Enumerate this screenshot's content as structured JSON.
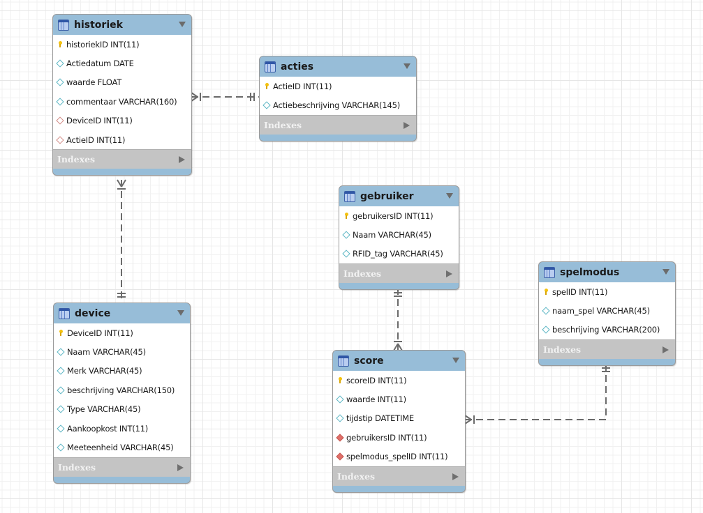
{
  "diagram": {
    "type": "EER diagram",
    "indexes_label": "Indexes",
    "tables": [
      {
        "id": "historiek",
        "name": "historiek",
        "columns": [
          {
            "label": "historiekID INT(11)",
            "kind": "primary-key"
          },
          {
            "label": "Actiedatum DATE",
            "kind": "column"
          },
          {
            "label": "waarde FLOAT",
            "kind": "column"
          },
          {
            "label": "commentaar VARCHAR(160)",
            "kind": "column"
          },
          {
            "label": "DeviceID INT(11)",
            "kind": "foreign-key"
          },
          {
            "label": "ActieID INT(11)",
            "kind": "foreign-key"
          }
        ]
      },
      {
        "id": "acties",
        "name": "acties",
        "columns": [
          {
            "label": "ActieID INT(11)",
            "kind": "primary-key"
          },
          {
            "label": "Actiebeschrijving VARCHAR(145)",
            "kind": "column"
          }
        ]
      },
      {
        "id": "device",
        "name": "device",
        "columns": [
          {
            "label": "DeviceID INT(11)",
            "kind": "primary-key"
          },
          {
            "label": "Naam VARCHAR(45)",
            "kind": "column"
          },
          {
            "label": "Merk VARCHAR(45)",
            "kind": "column"
          },
          {
            "label": "beschrijving VARCHAR(150)",
            "kind": "column"
          },
          {
            "label": "Type VARCHAR(45)",
            "kind": "column"
          },
          {
            "label": "Aankoopkost INT(11)",
            "kind": "column"
          },
          {
            "label": "Meeteenheid VARCHAR(45)",
            "kind": "column"
          }
        ]
      },
      {
        "id": "gebruiker",
        "name": "gebruiker",
        "columns": [
          {
            "label": "gebruikersID INT(11)",
            "kind": "primary-key"
          },
          {
            "label": "Naam VARCHAR(45)",
            "kind": "column"
          },
          {
            "label": "RFID_tag VARCHAR(45)",
            "kind": "column"
          }
        ]
      },
      {
        "id": "score",
        "name": "score",
        "columns": [
          {
            "label": "scoreID INT(11)",
            "kind": "primary-key"
          },
          {
            "label": "waarde INT(11)",
            "kind": "column"
          },
          {
            "label": "tijdstip DATETIME",
            "kind": "column"
          },
          {
            "label": "gebruikersID INT(11)",
            "kind": "foreign-key-identifying"
          },
          {
            "label": "spelmodus_spelID INT(11)",
            "kind": "foreign-key-identifying"
          }
        ]
      },
      {
        "id": "spelmodus",
        "name": "spelmodus",
        "columns": [
          {
            "label": "spelID INT(11)",
            "kind": "primary-key"
          },
          {
            "label": "naam_spel VARCHAR(45)",
            "kind": "column"
          },
          {
            "label": "beschrijving VARCHAR(200)",
            "kind": "column"
          }
        ]
      }
    ],
    "relationships": [
      {
        "from": "historiek",
        "to": "acties",
        "cardinality": "many-to-one"
      },
      {
        "from": "historiek",
        "to": "device",
        "cardinality": "many-to-one"
      },
      {
        "from": "score",
        "to": "gebruiker",
        "cardinality": "many-to-one"
      },
      {
        "from": "score",
        "to": "spelmodus",
        "cardinality": "many-to-one"
      }
    ],
    "colors": {
      "header": "#97bdd8",
      "indexes_bar": "#c4c4c4",
      "connector": "#6b6b6b",
      "primary_key": "#f4c20d",
      "column_marker": "#5cb6c4",
      "foreign_key_marker": "#d38b86",
      "identifying_fk_marker": "#e06f69"
    }
  }
}
